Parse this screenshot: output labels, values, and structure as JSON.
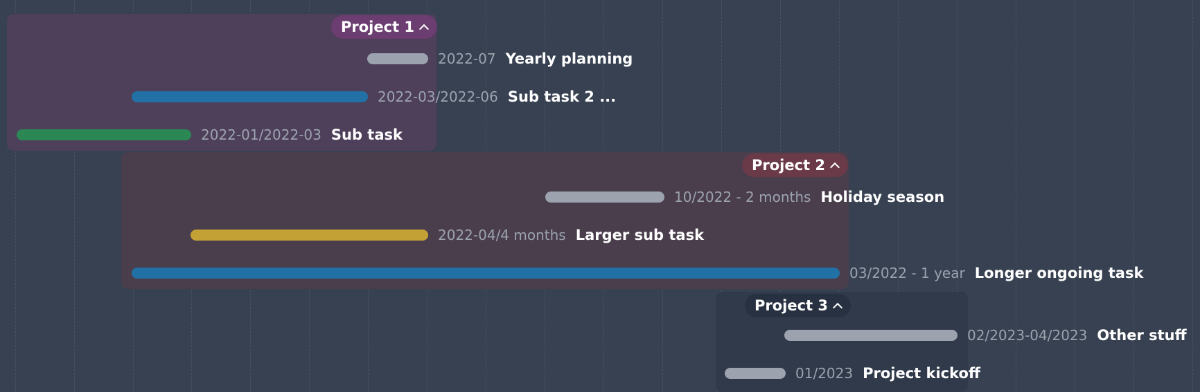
{
  "groups": [
    {
      "label": "Project 1",
      "badge_color": "#6b3d70",
      "box_color": "#4e3f5a",
      "items": [
        {
          "id": "yearly-planning",
          "title": "Yearly planning",
          "date_label": "2022-07",
          "color": "#9ca3af"
        },
        {
          "id": "sub-task-2",
          "title": "Sub task 2 ...",
          "date_label": "2022-03/2022-06",
          "color": "#2171a6"
        },
        {
          "id": "sub-task",
          "title": "Sub task",
          "date_label": "2022-01/2022-03",
          "color": "#2b8753"
        }
      ]
    },
    {
      "label": "Project 2",
      "badge_color": "#6b3a49",
      "box_color": "#4a3e4c",
      "items": [
        {
          "id": "holiday-season",
          "title": "Holiday season",
          "date_label": "10/2022 - 2 months",
          "color": "#9ca3af"
        },
        {
          "id": "larger-sub-task",
          "title": "Larger sub task",
          "date_label": "2022-04/4 months",
          "color": "#c3a134"
        },
        {
          "id": "longer-ongoing-task",
          "title": "Longer ongoing task",
          "date_label": "03/2022 - 1 year",
          "color": "#2171a6"
        }
      ]
    },
    {
      "label": "Project 3",
      "badge_color": "#283142",
      "box_color": "#313a4a",
      "items": [
        {
          "id": "other-stuff",
          "title": "Other stuff",
          "date_label": "02/2023-04/2023",
          "color": "#9ca3af"
        },
        {
          "id": "project-kickoff",
          "title": "Project kickoff",
          "date_label": "01/2023",
          "color": "#9ca3af"
        }
      ]
    }
  ]
}
